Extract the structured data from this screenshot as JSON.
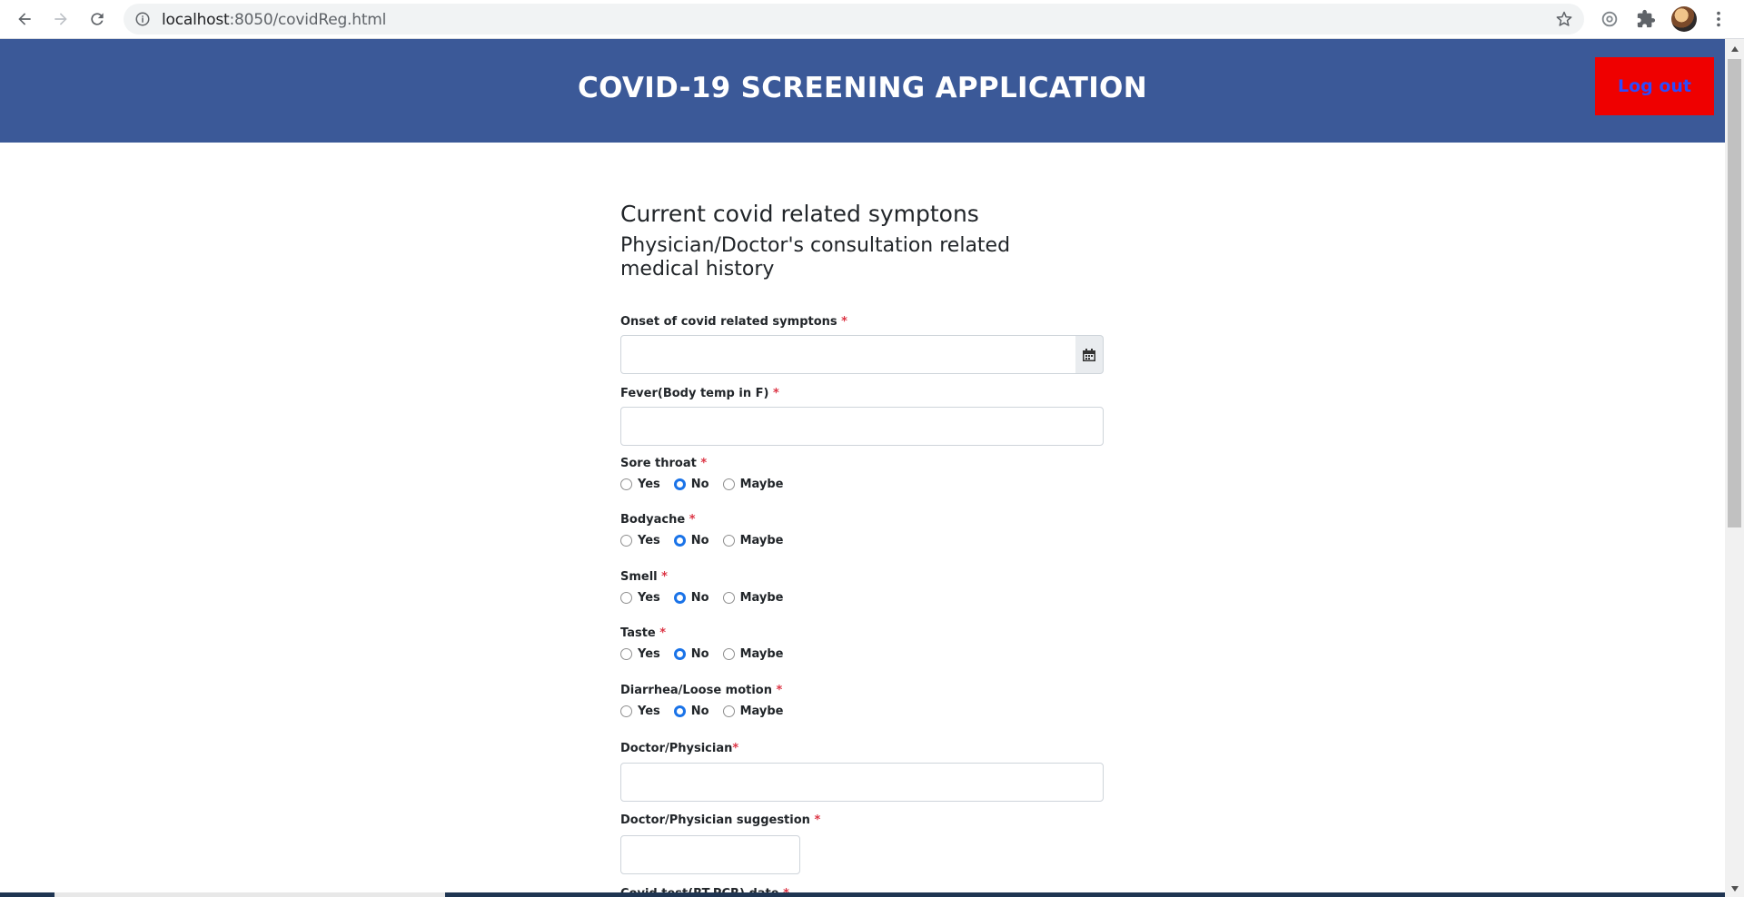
{
  "browser": {
    "url_host": "localhost",
    "url_path": ":8050/covidReg.html"
  },
  "header": {
    "title": "COVID-19 SCREENING APPLICATION",
    "logout_label": "Log out"
  },
  "form": {
    "heading": "Current covid related symptons",
    "subheading": "Physician/Doctor's consultation related medical history",
    "required_mark": "*",
    "onset_label": "Onset of covid related symptons",
    "onset_value": "",
    "fever_label": "Fever(Body temp in F)",
    "fever_value": "",
    "option_labels": [
      "Yes",
      "No",
      "Maybe"
    ],
    "radio_groups": [
      {
        "label": "Sore throat",
        "selected": "No"
      },
      {
        "label": "Bodyache",
        "selected": "No"
      },
      {
        "label": "Smell",
        "selected": "No"
      },
      {
        "label": "Taste",
        "selected": "No"
      },
      {
        "label": "Diarrhea/Loose motion",
        "selected": "No"
      }
    ],
    "doctor_label": "Doctor/Physician",
    "doctor_value": "",
    "suggestion_label": "Doctor/Physician suggestion",
    "suggestion_value": "",
    "next_label_partial": "Covid test(RT-PCR) date"
  },
  "colors": {
    "header_bg": "#3b5998",
    "logout_bg": "#ef0000",
    "logout_text": "#2b4bff",
    "required": "#dc3545",
    "radio_checked": "#1a73e8"
  }
}
